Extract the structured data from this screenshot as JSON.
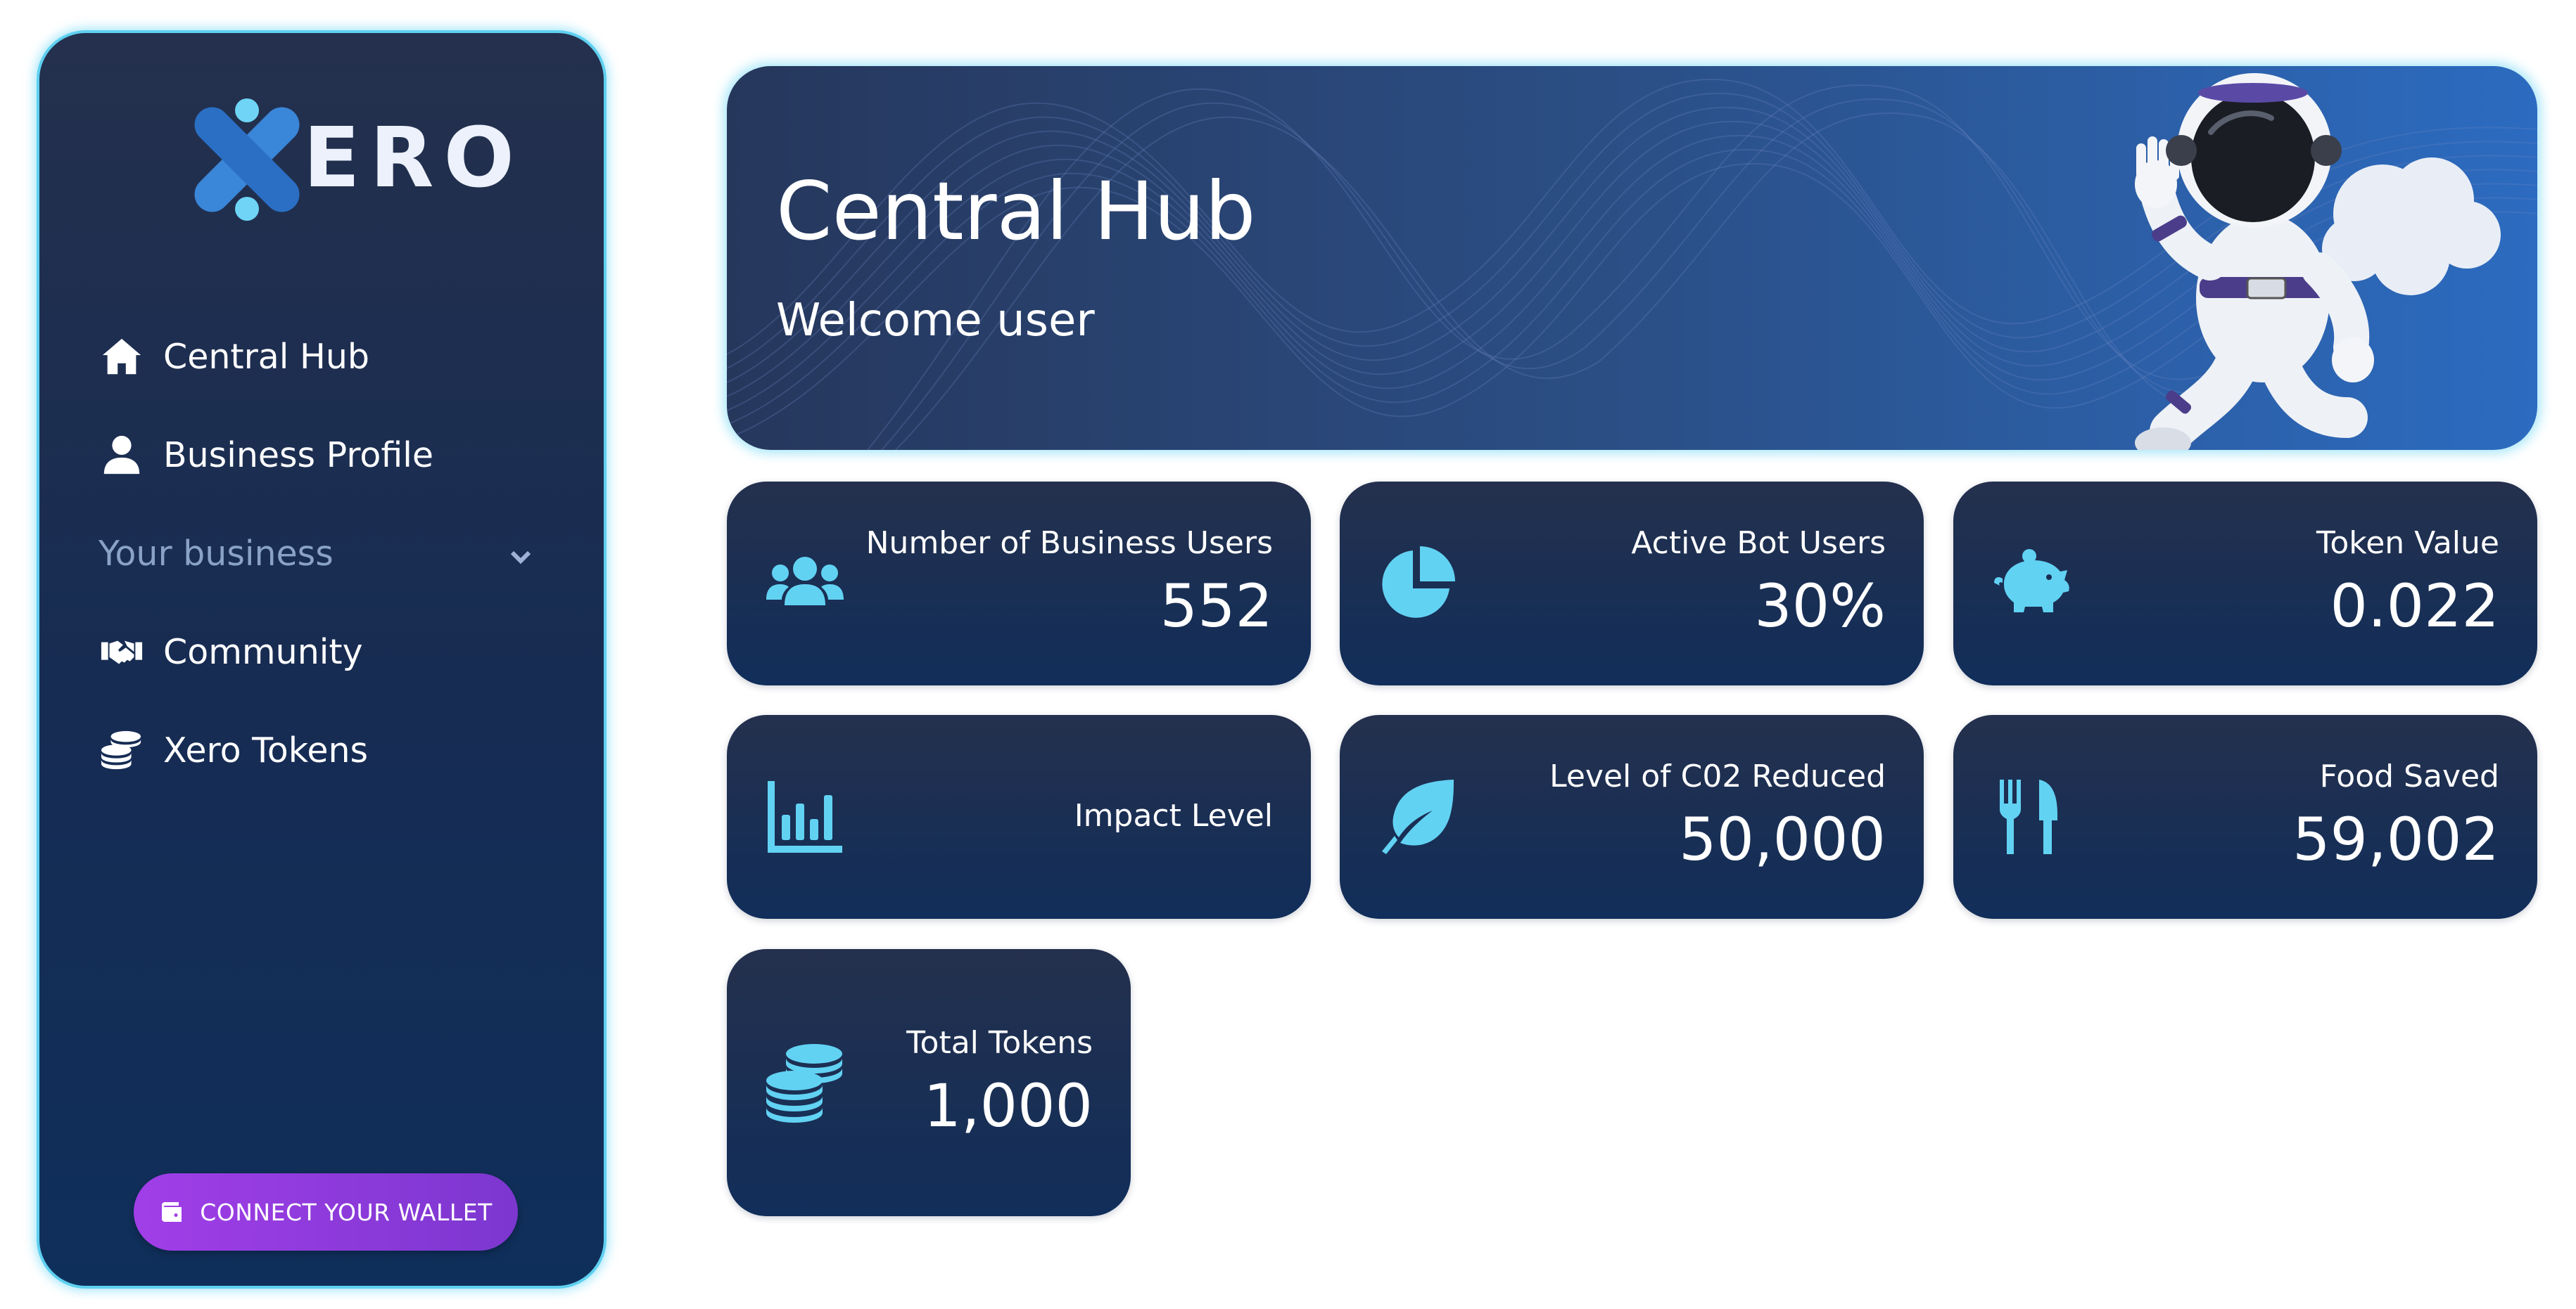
{
  "brand": {
    "logo_text": "ERO",
    "colors": {
      "accent": "#62d2f3",
      "sidebar_border": "#5fd0f0",
      "button": "#9b3de3"
    }
  },
  "sidebar": {
    "items": [
      {
        "label": "Central Hub",
        "icon": "home-icon"
      },
      {
        "label": "Business Profile",
        "icon": "user-icon"
      },
      {
        "label": "Your business",
        "icon": "chevron-down-icon"
      },
      {
        "label": "Community",
        "icon": "handshake-icon"
      },
      {
        "label": "Xero Tokens",
        "icon": "coins-icon"
      }
    ],
    "wallet_button": {
      "label": "CONNECT YOUR WALLET",
      "icon": "wallet-icon"
    }
  },
  "banner": {
    "title": "Central Hub",
    "subtitle": "Welcome user"
  },
  "stats": [
    {
      "label": "Number of Business Users",
      "value": "552",
      "icon": "users-icon"
    },
    {
      "label": "Active Bot Users",
      "value": "30%",
      "icon": "pie-chart-icon"
    },
    {
      "label": "Token Value",
      "value": "0.022",
      "icon": "piggy-bank-icon"
    },
    {
      "label": "Impact Level",
      "value": "",
      "icon": "bar-chart-icon"
    },
    {
      "label": "Level of C02 Reduced",
      "value": "50,000",
      "icon": "leaf-icon"
    },
    {
      "label": "Food Saved",
      "value": "59,002",
      "icon": "utensils-icon"
    },
    {
      "label": "Total Tokens",
      "value": "1,000",
      "icon": "coins-icon"
    }
  ]
}
